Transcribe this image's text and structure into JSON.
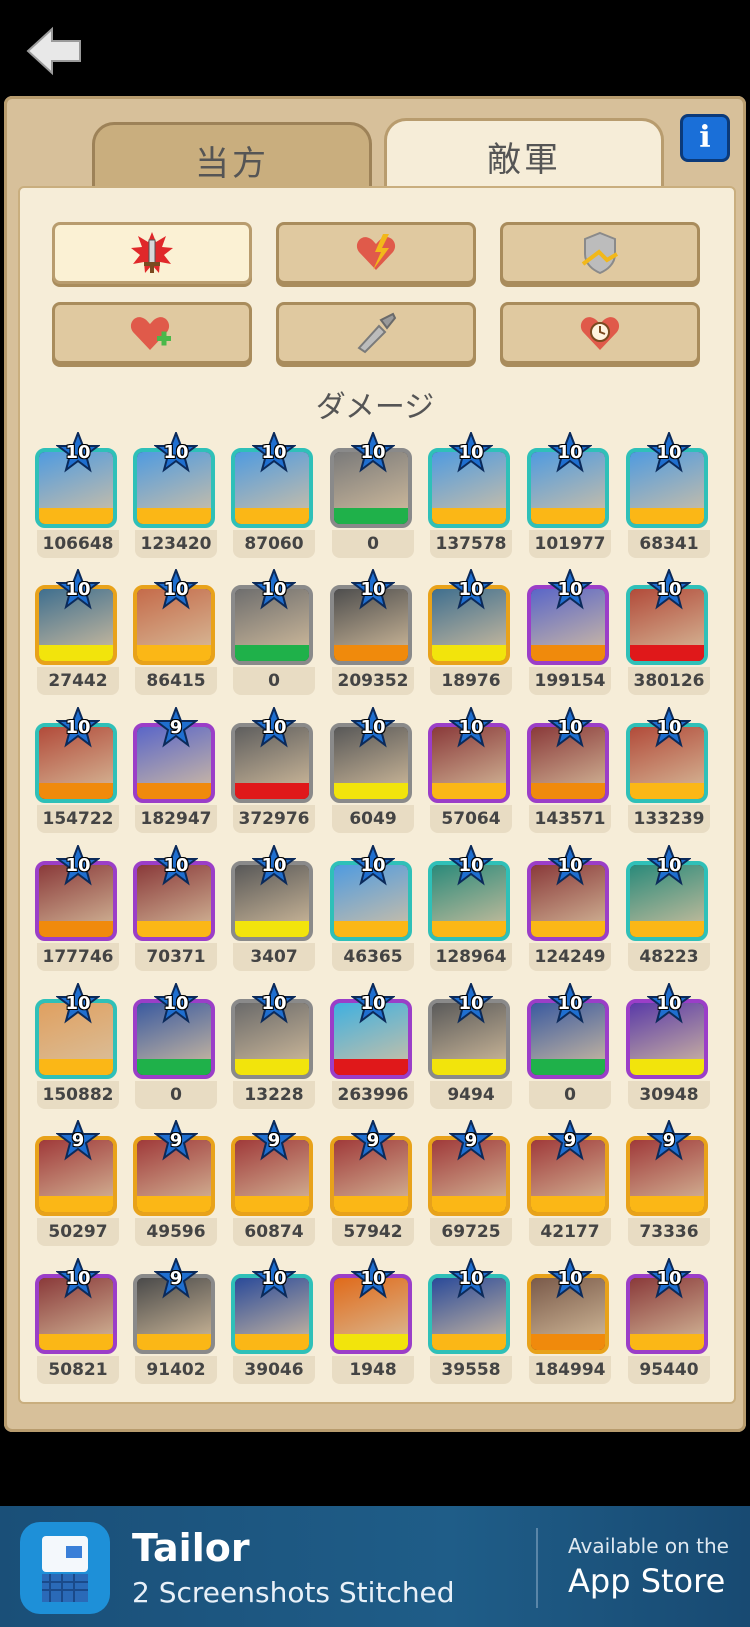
{
  "nav": {
    "back_icon": "back-arrow-icon"
  },
  "tabs": [
    {
      "label": "当方",
      "active": false
    },
    {
      "label": "敵軍",
      "active": true
    }
  ],
  "info_button": "i",
  "filters": [
    {
      "icon": "sword-burst-icon",
      "active": true
    },
    {
      "icon": "heart-lightning-icon",
      "active": false
    },
    {
      "icon": "shield-arrow-icon",
      "active": false
    },
    {
      "icon": "heart-plus-icon",
      "active": false
    },
    {
      "icon": "syringe-knife-icon",
      "active": false
    },
    {
      "icon": "heart-clock-icon",
      "active": false
    }
  ],
  "section_title": "ダメージ",
  "colors": {
    "teal": "#2fc0b8",
    "gold": "#e8a21a",
    "gray": "#8a8a8a",
    "purple": "#9b3ec8",
    "bar_orange": "#f08a0c",
    "bar_yellow": "#f2e40c",
    "bar_green": "#1fb14a",
    "bar_red": "#e0181a",
    "bar_amber": "#fbb716"
  },
  "units": [
    [
      {
        "level": "10",
        "value": "106648",
        "frame": "teal",
        "bar": "bar_amber",
        "art": "#4f9be0"
      },
      {
        "level": "10",
        "value": "123420",
        "frame": "teal",
        "bar": "bar_amber",
        "art": "#4f9be0"
      },
      {
        "level": "10",
        "value": "87060",
        "frame": "teal",
        "bar": "bar_amber",
        "art": "#4f9be0"
      },
      {
        "level": "10",
        "value": "0",
        "frame": "gray",
        "bar": "bar_green",
        "art": "#7a7a7a"
      },
      {
        "level": "10",
        "value": "137578",
        "frame": "teal",
        "bar": "bar_amber",
        "art": "#4f9be0"
      },
      {
        "level": "10",
        "value": "101977",
        "frame": "teal",
        "bar": "bar_amber",
        "art": "#4f9be0"
      },
      {
        "level": "10",
        "value": "68341",
        "frame": "teal",
        "bar": "bar_amber",
        "art": "#4f9be0"
      }
    ],
    [
      {
        "level": "10",
        "value": "27442",
        "frame": "gold",
        "bar": "bar_yellow",
        "art": "#3f6f8f"
      },
      {
        "level": "10",
        "value": "86415",
        "frame": "gold",
        "bar": "bar_amber",
        "art": "#c56b4a"
      },
      {
        "level": "10",
        "value": "0",
        "frame": "gray",
        "bar": "bar_green",
        "art": "#6e6e6e"
      },
      {
        "level": "10",
        "value": "209352",
        "frame": "gray",
        "bar": "bar_orange",
        "art": "#4e4e4e"
      },
      {
        "level": "10",
        "value": "18976",
        "frame": "gold",
        "bar": "bar_yellow",
        "art": "#3f6f8f"
      },
      {
        "level": "10",
        "value": "199154",
        "frame": "purple",
        "bar": "bar_orange",
        "art": "#5a66c8"
      },
      {
        "level": "10",
        "value": "380126",
        "frame": "teal",
        "bar": "bar_red",
        "art": "#b24b3a"
      }
    ],
    [
      {
        "level": "10",
        "value": "154722",
        "frame": "teal",
        "bar": "bar_orange",
        "art": "#b24b3a"
      },
      {
        "level": "9",
        "value": "182947",
        "frame": "purple",
        "bar": "bar_orange",
        "art": "#5a66c8"
      },
      {
        "level": "10",
        "value": "372976",
        "frame": "gray",
        "bar": "bar_red",
        "art": "#5e5e5e"
      },
      {
        "level": "10",
        "value": "6049",
        "frame": "gray",
        "bar": "bar_yellow",
        "art": "#585858"
      },
      {
        "level": "10",
        "value": "57064",
        "frame": "purple",
        "bar": "bar_amber",
        "art": "#8a3a3a"
      },
      {
        "level": "10",
        "value": "143571",
        "frame": "purple",
        "bar": "bar_orange",
        "art": "#8a3a3a"
      },
      {
        "level": "10",
        "value": "133239",
        "frame": "teal",
        "bar": "bar_amber",
        "art": "#b24b3a"
      }
    ],
    [
      {
        "level": "10",
        "value": "177746",
        "frame": "purple",
        "bar": "bar_orange",
        "art": "#8a3a3a"
      },
      {
        "level": "10",
        "value": "70371",
        "frame": "purple",
        "bar": "bar_amber",
        "art": "#8a3a3a"
      },
      {
        "level": "10",
        "value": "3407",
        "frame": "gray",
        "bar": "bar_yellow",
        "art": "#585858"
      },
      {
        "level": "10",
        "value": "46365",
        "frame": "teal",
        "bar": "bar_amber",
        "art": "#4f9be0"
      },
      {
        "level": "10",
        "value": "128964",
        "frame": "teal",
        "bar": "bar_amber",
        "art": "#2a8a7a"
      },
      {
        "level": "10",
        "value": "124249",
        "frame": "purple",
        "bar": "bar_amber",
        "art": "#8a3a3a"
      },
      {
        "level": "10",
        "value": "48223",
        "frame": "teal",
        "bar": "bar_amber",
        "art": "#2a8a7a"
      }
    ],
    [
      {
        "level": "10",
        "value": "150882",
        "frame": "teal",
        "bar": "bar_amber",
        "art": "#e0a060"
      },
      {
        "level": "10",
        "value": "0",
        "frame": "purple",
        "bar": "bar_green",
        "art": "#3a5aa0"
      },
      {
        "level": "10",
        "value": "13228",
        "frame": "gray",
        "bar": "bar_yellow",
        "art": "#6a6a6a"
      },
      {
        "level": "10",
        "value": "263996",
        "frame": "purple",
        "bar": "bar_red",
        "art": "#3fb0e0"
      },
      {
        "level": "10",
        "value": "9494",
        "frame": "gray",
        "bar": "bar_yellow",
        "art": "#5a5a5a"
      },
      {
        "level": "10",
        "value": "0",
        "frame": "purple",
        "bar": "bar_green",
        "art": "#3a5aa0"
      },
      {
        "level": "10",
        "value": "30948",
        "frame": "purple",
        "bar": "bar_yellow",
        "art": "#5a3aa8"
      }
    ],
    [
      {
        "level": "9",
        "value": "50297",
        "frame": "gold",
        "bar": "bar_amber",
        "art": "#a03a3a"
      },
      {
        "level": "9",
        "value": "49596",
        "frame": "gold",
        "bar": "bar_amber",
        "art": "#a03a3a"
      },
      {
        "level": "9",
        "value": "60874",
        "frame": "gold",
        "bar": "bar_amber",
        "art": "#a03a3a"
      },
      {
        "level": "9",
        "value": "57942",
        "frame": "gold",
        "bar": "bar_amber",
        "art": "#a03a3a"
      },
      {
        "level": "9",
        "value": "69725",
        "frame": "gold",
        "bar": "bar_amber",
        "art": "#a03a3a"
      },
      {
        "level": "9",
        "value": "42177",
        "frame": "gold",
        "bar": "bar_amber",
        "art": "#a03a3a"
      },
      {
        "level": "9",
        "value": "73336",
        "frame": "gold",
        "bar": "bar_amber",
        "art": "#a03a3a"
      }
    ],
    [
      {
        "level": "10",
        "value": "50821",
        "frame": "purple",
        "bar": "bar_amber",
        "art": "#8a3a3a"
      },
      {
        "level": "9",
        "value": "91402",
        "frame": "gray",
        "bar": "bar_amber",
        "art": "#4a4a4a"
      },
      {
        "level": "10",
        "value": "39046",
        "frame": "teal",
        "bar": "bar_amber",
        "art": "#2a4a9a"
      },
      {
        "level": "10",
        "value": "1948",
        "frame": "purple",
        "bar": "bar_yellow",
        "art": "#e06a1a"
      },
      {
        "level": "10",
        "value": "39558",
        "frame": "teal",
        "bar": "bar_amber",
        "art": "#2a4a9a"
      },
      {
        "level": "10",
        "value": "184994",
        "frame": "gold",
        "bar": "bar_orange",
        "art": "#7a5a4a"
      },
      {
        "level": "10",
        "value": "95440",
        "frame": "purple",
        "bar": "bar_amber",
        "art": "#8a3a3a"
      }
    ]
  ],
  "banner": {
    "app_name": "Tailor",
    "subtitle": "2 Screenshots Stitched",
    "available": "Available on the",
    "store": "App Store"
  }
}
